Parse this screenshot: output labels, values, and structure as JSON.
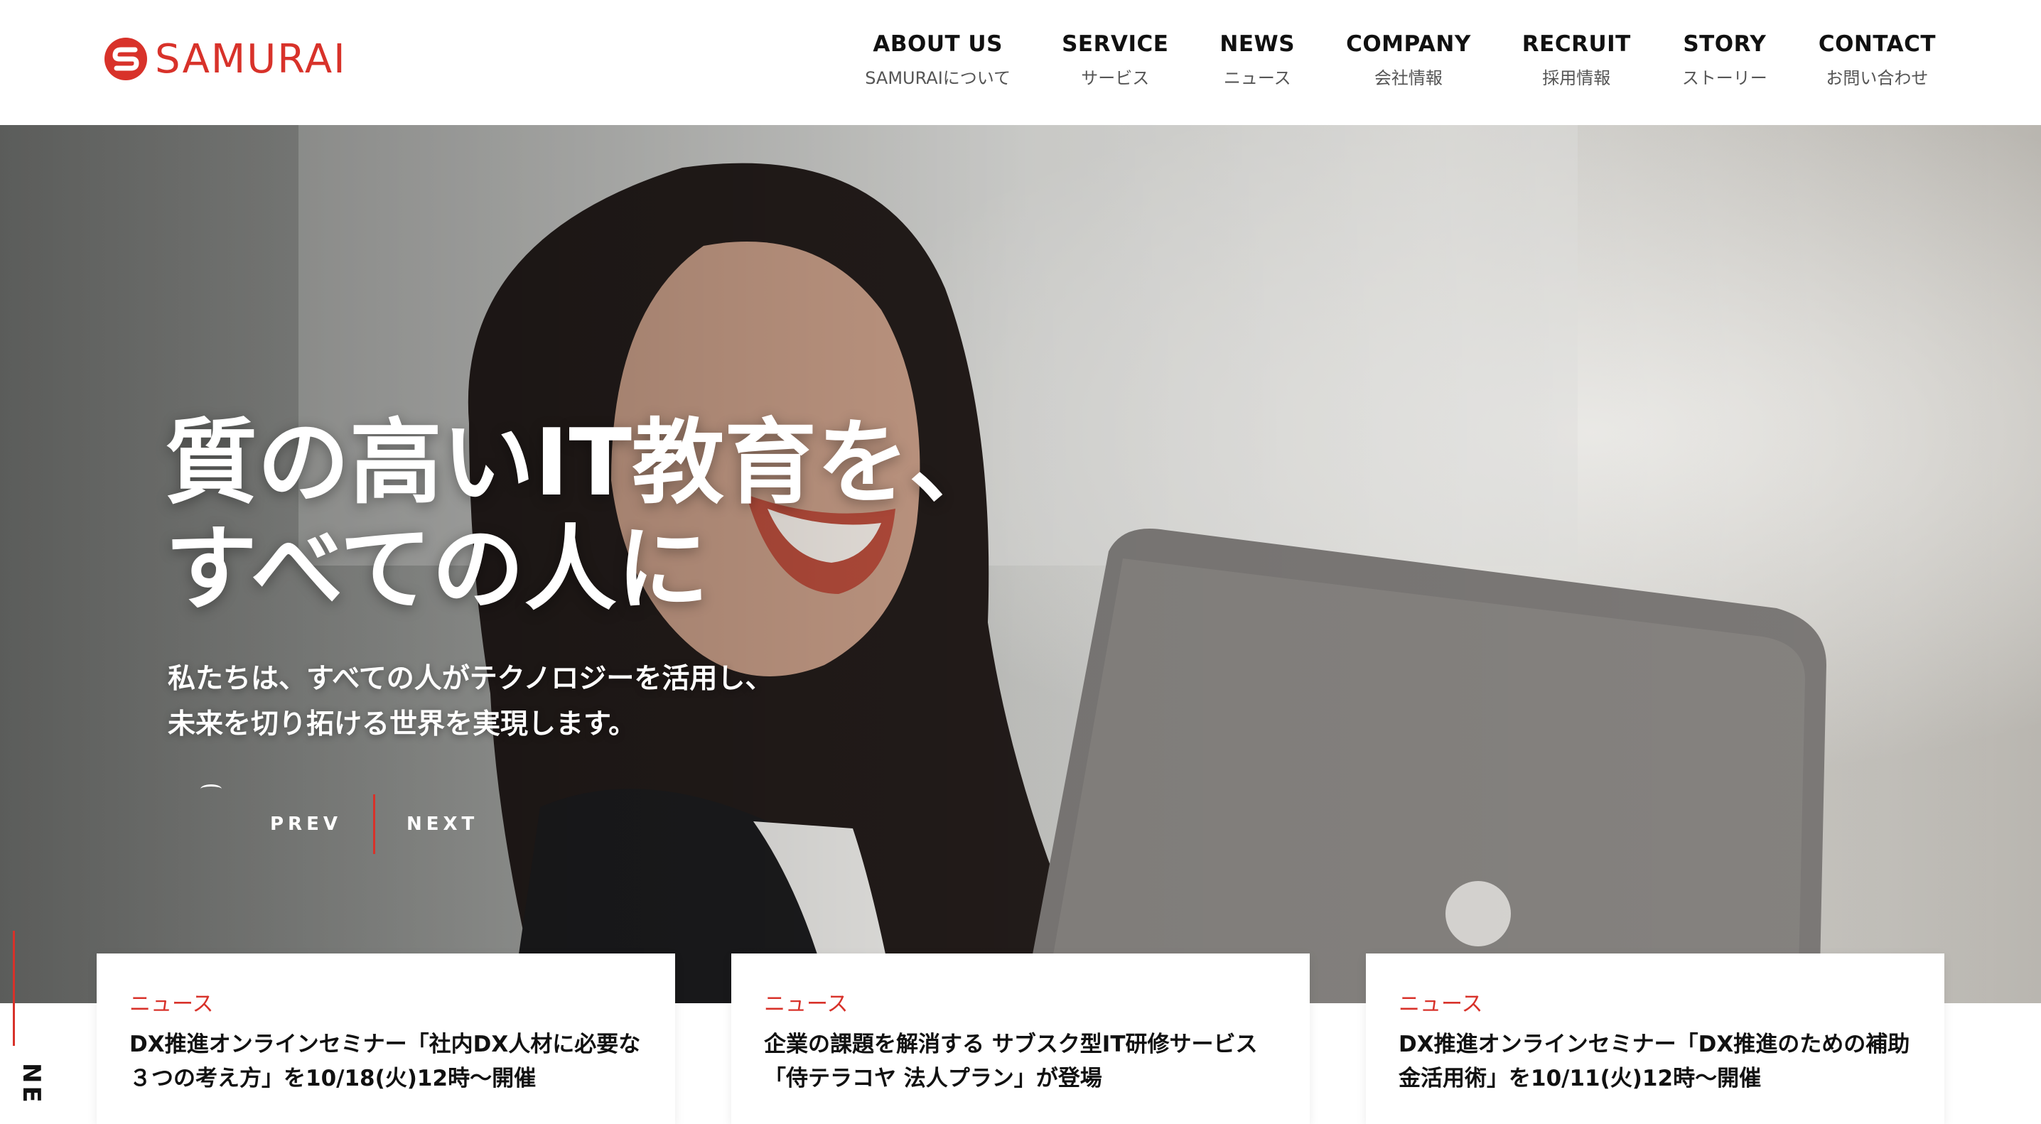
{
  "brand": {
    "name": "SAMURAI",
    "accent": "#d8322a"
  },
  "nav": [
    {
      "en": "ABOUT US",
      "jp": "SAMURAIについて"
    },
    {
      "en": "SERVICE",
      "jp": "サービス"
    },
    {
      "en": "NEWS",
      "jp": "ニュース"
    },
    {
      "en": "COMPANY",
      "jp": "会社情報"
    },
    {
      "en": "RECRUIT",
      "jp": "採用情報"
    },
    {
      "en": "STORY",
      "jp": "ストーリー"
    },
    {
      "en": "CONTACT",
      "jp": "お問い合わせ"
    }
  ],
  "hero": {
    "title_line1": "質の高いIT教育を、",
    "title_line2": "すべての人に",
    "sub_line1": "私たちは、すべての人がテクノロジーを活用し、",
    "sub_line2": "未来を切り拓ける世界を実現します。",
    "prev": "PREV",
    "next": "NEXT"
  },
  "side": {
    "label": "NEWS"
  },
  "news": [
    {
      "category": "ニュース",
      "title": "DX推進オンラインセミナー「社内DX人材に必要な３つの考え方」を10/18(火)12時〜開催"
    },
    {
      "category": "ニュース",
      "title": "企業の課題を解消する サブスク型IT研修サービス「侍テラコヤ 法人プラン」が登場"
    },
    {
      "category": "ニュース",
      "title": "DX推進オンラインセミナー「DX推進のための補助金活用術」を10/11(火)12時〜開催"
    }
  ]
}
